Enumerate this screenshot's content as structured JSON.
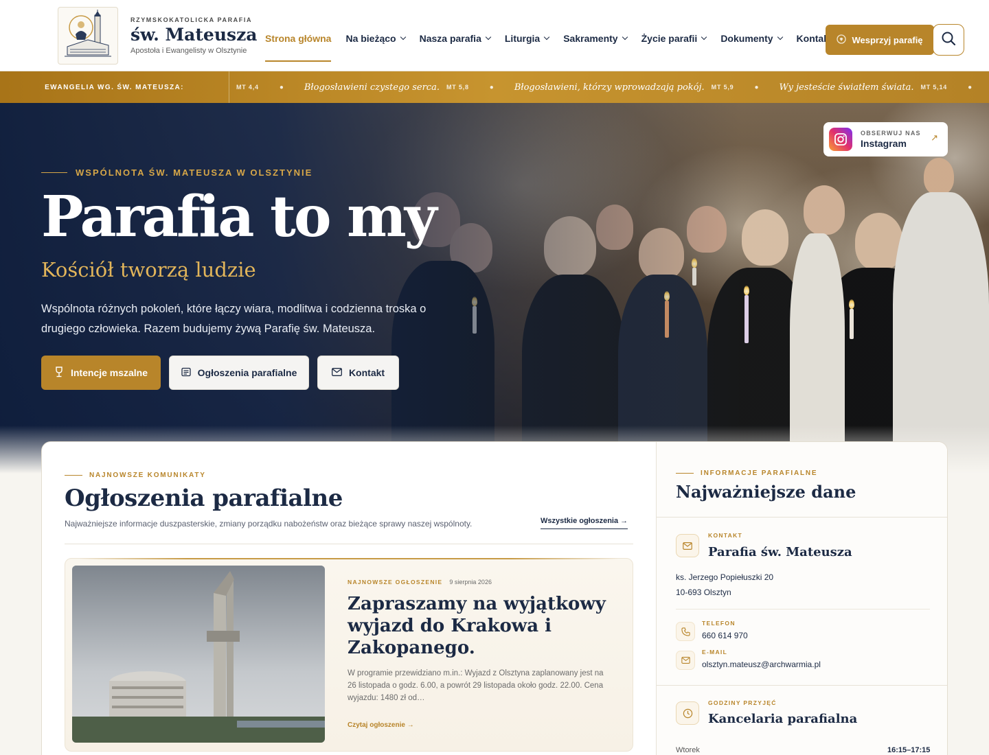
{
  "header": {
    "logo_small": "RZYMSKOKATOLICKA PARAFIA",
    "logo_main": "św. Mateusza",
    "logo_sub": "Apostoła i Ewangelisty w Olsztynie",
    "nav": [
      {
        "label": "Strona główna",
        "active": true,
        "dropdown": false
      },
      {
        "label": "Na bieżąco",
        "active": false,
        "dropdown": true
      },
      {
        "label": "Nasza parafia",
        "active": false,
        "dropdown": true
      },
      {
        "label": "Liturgia",
        "active": false,
        "dropdown": true
      },
      {
        "label": "Sakramenty",
        "active": false,
        "dropdown": true
      },
      {
        "label": "Życie parafii",
        "active": false,
        "dropdown": true
      },
      {
        "label": "Dokumenty",
        "active": false,
        "dropdown": true
      },
      {
        "label": "Kontakt",
        "active": false,
        "dropdown": false
      }
    ],
    "support_label": "Wesprzyj parafię",
    "search_icon": "search-icon"
  },
  "ticker": {
    "label": "EWANGELIA WG. ŚW. MATEUSZA:",
    "items": [
      {
        "ref": "MT 4,4",
        "quote": ""
      },
      {
        "ref": "MT 5,8",
        "quote": "Błogosławieni czystego serca."
      },
      {
        "ref": "MT 5,9",
        "quote": "Błogosławieni, którzy wprowadzają pokój."
      },
      {
        "ref": "MT 5,14",
        "quote": "Wy jesteście światłem świata."
      }
    ]
  },
  "hero": {
    "eyebrow": "WSPÓLNOTA ŚW. MATEUSZA W OLSZTYNIE",
    "title": "Parafia to my",
    "subtitle": "Kościół tworzą ludzie",
    "description": "Wspólnota różnych pokoleń, które łączy wiara, modlitwa i codzienna troska o drugiego człowieka. Razem budujemy żywą Parafię św. Mateusza.",
    "buttons": [
      {
        "label": "Intencje mszalne",
        "icon": "chalice-icon"
      },
      {
        "label": "Ogłoszenia parafialne",
        "icon": "document-icon"
      },
      {
        "label": "Kontakt",
        "icon": "mail-icon"
      }
    ],
    "instagram": {
      "small": "OBSERWUJ NAS",
      "main": "Instagram",
      "arrow": "↗"
    }
  },
  "announcements": {
    "eyebrow": "NAJNOWSZE KOMUNIKATY",
    "title": "Ogłoszenia parafialne",
    "description": "Najważniejsze informacje duszpasterskie, zmiany porządku nabożeństw oraz bieżące sprawy naszej wspólnoty.",
    "all_link": "Wszystkie ogłoszenia",
    "featured": {
      "tag": "NAJNOWSZE OGŁOSZENIE",
      "date": "9 sierpnia 2026",
      "title": "Zapraszamy na wyjątkowy wyjazd do Krakowa i Zakopanego.",
      "text": "W programie przewidziano m.in.: Wyjazd z Olsztyna zaplanowany jest na 26 listopada o godz. 6.00, a powrót 29 listopada około godz. 22.00. Cena wyjazdu: 1480 zł od…",
      "link": "Czytaj ogłoszenie"
    }
  },
  "info": {
    "eyebrow": "INFORMACJE PARAFIALNE",
    "title": "Najważniejsze dane",
    "contact": {
      "label": "KONTAKT",
      "name": "Parafia św. Mateusza",
      "address1": "ks. Jerzego Popiełuszki 20",
      "address2": "10-693 Olsztyn"
    },
    "phone": {
      "label": "TELEFON",
      "value": "660 614 970"
    },
    "email": {
      "label": "E-MAIL",
      "value": "olsztyn.mateusz@archwarmia.pl"
    },
    "office": {
      "label": "GODZINY PRZYJĘĆ",
      "name": "Kancelaria parafialna",
      "rows": [
        {
          "day": "Wtorek",
          "hours": "16:15–17:15"
        }
      ]
    }
  },
  "colors": {
    "gold": "#b8852a",
    "navy": "#1c2a44"
  }
}
